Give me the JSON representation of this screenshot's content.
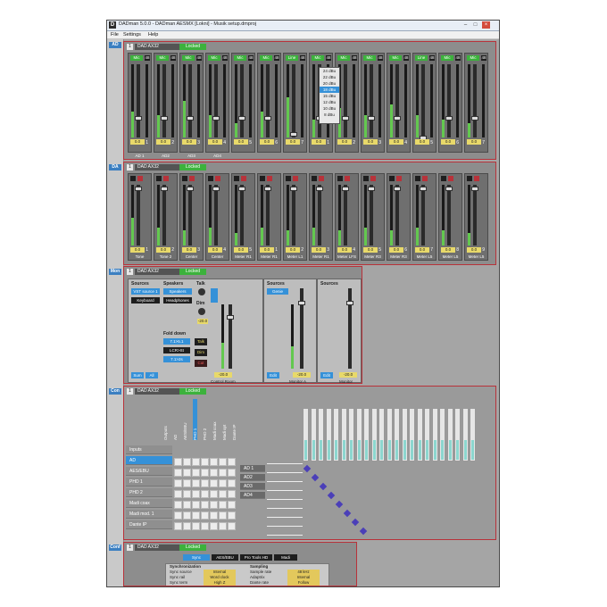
{
  "window": {
    "app_icon": "D",
    "title": "DADman 5.0.0 - DADman AESMX [Lokni] - Musik setup.dmproj",
    "controls": [
      "–",
      "□",
      "×"
    ]
  },
  "menu": [
    "File",
    "Settings",
    "Help"
  ],
  "colors": {
    "accent": "#3591d8",
    "locked": "#3cb23c",
    "frame": "#b8323a",
    "meter": "#63c84f",
    "gain": "#e8d96a"
  },
  "sections": {
    "ad": {
      "tab": "AD",
      "num": "1",
      "device": "DAD AX32",
      "status": "Locked",
      "modes": [
        "Mic",
        "Mic",
        "Mic",
        "Mic",
        "Mic",
        "Mic",
        "Line",
        "Mic",
        "Mic",
        "Mic",
        "Mic",
        "Line",
        "Mic",
        "Mic"
      ],
      "gain": "0.0",
      "numbers": [
        "1",
        "2",
        "3",
        "4",
        "5",
        "6",
        "7",
        "1",
        "2",
        "3",
        "4",
        "5",
        "6",
        "7"
      ],
      "names": [
        "AD 1",
        "AD2",
        "AD3",
        "AD4"
      ],
      "menu_levels": [
        "24 dBu",
        "22 dBu",
        "20 dBu",
        "18 dBu",
        "15 dBu",
        "12 dBu",
        "10 dBu",
        "8 dBu"
      ]
    },
    "da": {
      "tab": "DA",
      "num": "1",
      "device": "DAD AX32",
      "status": "Locked",
      "gain": "0.0",
      "numbers": [
        "1",
        "2",
        "3",
        "4",
        "5",
        "1",
        "2",
        "3",
        "4",
        "5",
        "6",
        "7",
        "8",
        "9"
      ],
      "names": [
        "Tone",
        "Tone 2",
        "Center",
        "Center",
        "Meter R1",
        "Meter R1",
        "Meter L1",
        "Meter R1",
        "Meter LFS",
        "Meter R3",
        "Meter R3",
        "Meter L5",
        "Meter L5",
        "Meter L5"
      ]
    },
    "mon": {
      "tab": "Mon",
      "num": "1",
      "device": "DAD AX32",
      "status": "Locked",
      "sources_title": "Sources",
      "sources": [
        "VST source 1",
        "Keyboard"
      ],
      "speakers_title": "Speakers",
      "speakers": [
        "Speakers",
        "Headphones"
      ],
      "talk": "Talk",
      "dim": "Dim",
      "fold_title": "Fold down",
      "fold": [
        "7.1>5.1",
        "LCR>St",
        "7.1>2s"
      ],
      "side_btns": [
        "Talk",
        "Dim",
        "Cut"
      ],
      "bottom_btns": [
        "Sum",
        "All"
      ],
      "edit": "Edit",
      "control_room": "Control Room",
      "sources2_title": "Sources",
      "sources2": [
        "Genie"
      ],
      "sources3_title": "Sources",
      "monitor_a": "Monitor A",
      "monitor": "Monitor",
      "value": "-20.0"
    },
    "con": {
      "tab": "Con",
      "num": "1",
      "device": "DAD AX32",
      "status": "Locked",
      "col_headers": [
        "Outputs",
        "AD",
        "AES/EBU",
        "PHD 1",
        "PHD 2",
        "Madi coax",
        "Madi opt",
        "Dante IP"
      ],
      "rows": [
        "Inputs",
        "AD",
        "AES/EBU",
        "PHD 1",
        "PHD 2",
        "Madi coax",
        "Madi mod. 1",
        "Dante IP"
      ],
      "sub_rows": [
        "AD 1",
        "AD2",
        "AD3",
        "AD4"
      ]
    },
    "conf": {
      "tab": "Conf",
      "num": "1",
      "device": "DAD AX32",
      "status": "Locked",
      "tabs": [
        "Sync",
        "AES/EBU",
        "Pro Tools HD",
        "Madi"
      ],
      "sync_title": "Synchronization",
      "sampling_title": "Sampling",
      "sync_fields": [
        {
          "label": "Sync source",
          "value": "Internal"
        },
        {
          "label": "Sync rail",
          "value": "Word clock"
        },
        {
          "label": "Sync term",
          "value": "High Z"
        }
      ],
      "sampling_fields": [
        {
          "label": "Sample rate",
          "value": "48 kHz"
        },
        {
          "label": "Adaptrix",
          "value": "Internal"
        },
        {
          "label": "Dante rate",
          "value": "Follow"
        }
      ]
    }
  }
}
